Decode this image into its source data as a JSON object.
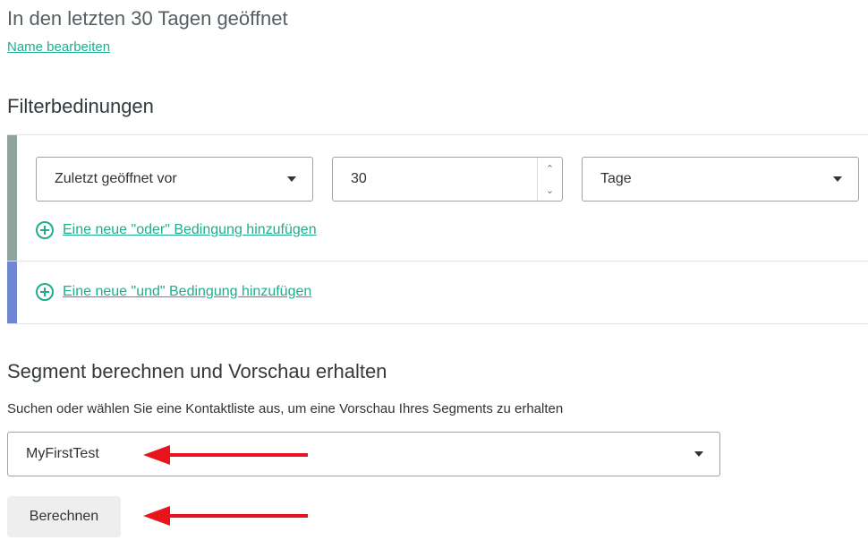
{
  "header": {
    "segment_name": "In den letzten 30 Tagen geöffnet",
    "rename_link": "Name bearbeiten"
  },
  "filter": {
    "title": "Filterbedinungen",
    "condition": {
      "field_select": "Zuletzt geöffnet vor",
      "number_value": "30",
      "unit_select": "Tage"
    },
    "add_or_label": "Eine neue \"oder\" Bedingung hinzufügen",
    "add_and_label": "Eine neue \"und\" Bedingung hinzufügen"
  },
  "preview": {
    "title": "Segment berechnen und Vorschau erhalten",
    "helper": "Suchen oder wählen Sie eine Kontaktliste aus, um eine Vorschau Ihres Segments zu erhalten",
    "contact_list_select": "MyFirstTest",
    "calculate_button": "Berechnen"
  },
  "colors": {
    "accent": "#1fae8c",
    "or_bar": "#8fa39e",
    "and_bar": "#6f86d0",
    "annotation_arrow": "#e8141b"
  },
  "icons": [
    "plus-circle-icon",
    "chevron-down-icon",
    "spinner-up-icon",
    "spinner-down-icon",
    "arrow-left-icon"
  ]
}
